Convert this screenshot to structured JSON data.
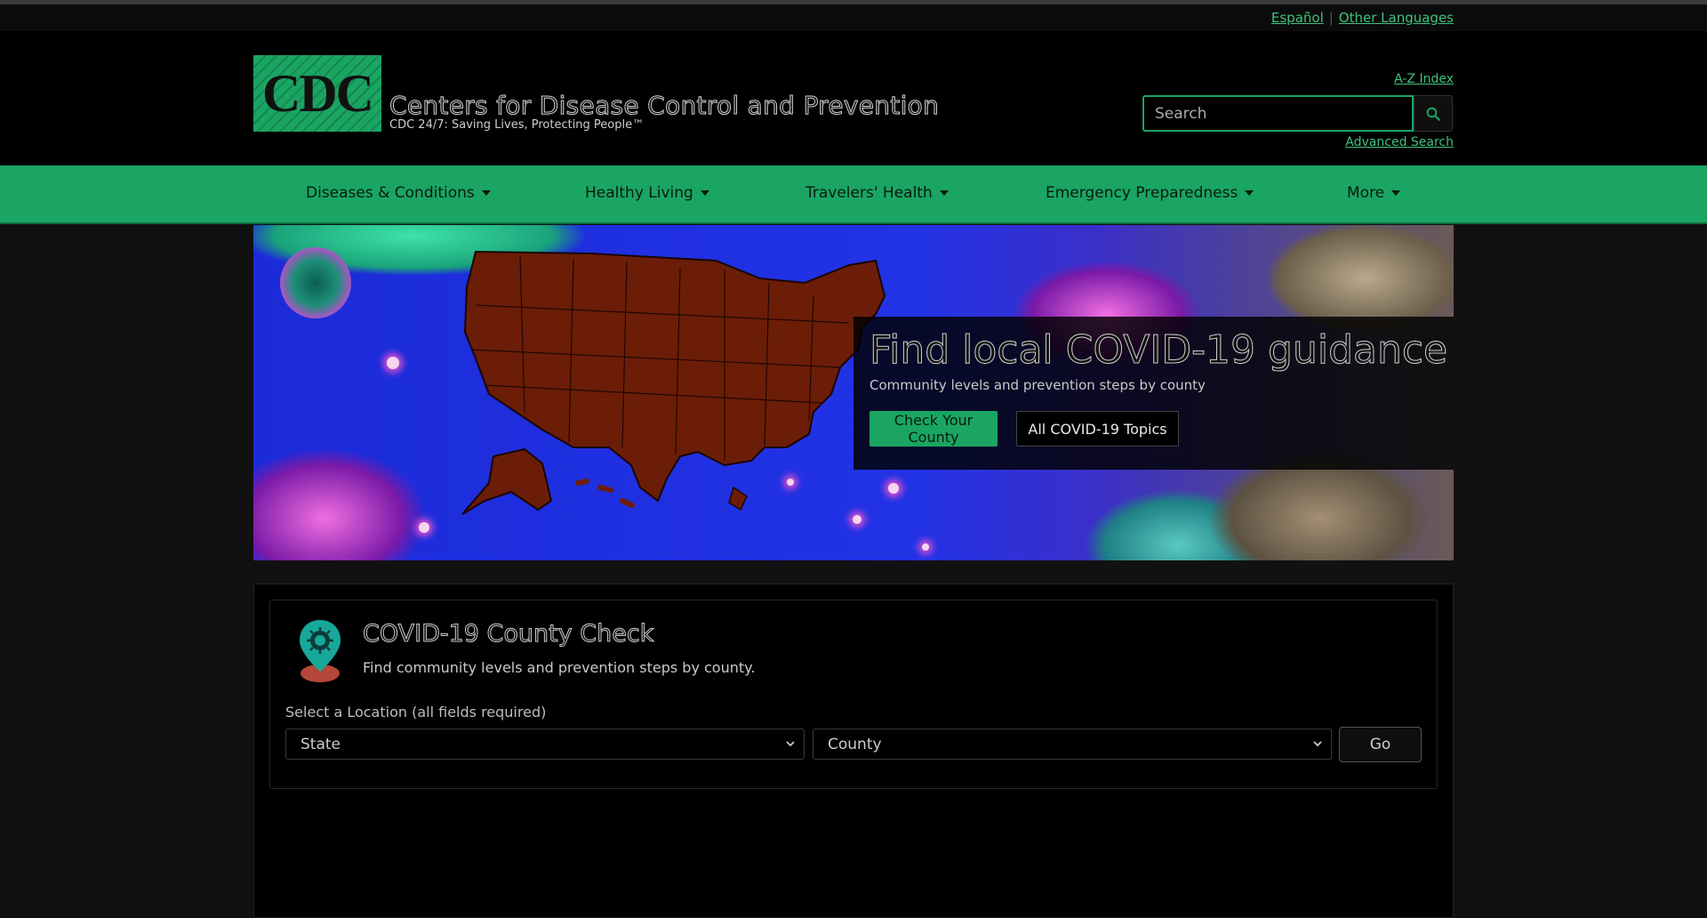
{
  "languages": {
    "spanish": "Español",
    "other": "Other Languages"
  },
  "header": {
    "logo_text": "CDC",
    "org_name": "Centers for Disease Control and Prevention",
    "tagline": "CDC 24/7: Saving Lives, Protecting People™",
    "az_index": "A-Z Index",
    "search_placeholder": "Search",
    "advanced_search": "Advanced Search"
  },
  "nav": {
    "items": [
      {
        "label": "Diseases & Conditions"
      },
      {
        "label": "Healthy Living"
      },
      {
        "label": "Travelers' Health"
      },
      {
        "label": "Emergency Preparedness"
      },
      {
        "label": "More"
      }
    ]
  },
  "hero": {
    "title": "Find local COVID-19 guidance",
    "subtitle": "Community levels and prevention steps by county",
    "primary_button": "Check Your County",
    "secondary_button": "All COVID-19 Topics"
  },
  "county_check": {
    "title": "COVID-19 County Check",
    "subtitle": "Find community levels and prevention steps by county.",
    "location_label": "Select a Location (all fields required)",
    "state_select": "State",
    "county_select": "County",
    "go_button": "Go"
  },
  "colors": {
    "brand_green": "#1aa563",
    "link_green": "#3fc27d",
    "background": "#000000"
  },
  "icons": [
    "search-icon",
    "caret-down-icon",
    "location-pin-icon",
    "chevron-down-icon"
  ]
}
